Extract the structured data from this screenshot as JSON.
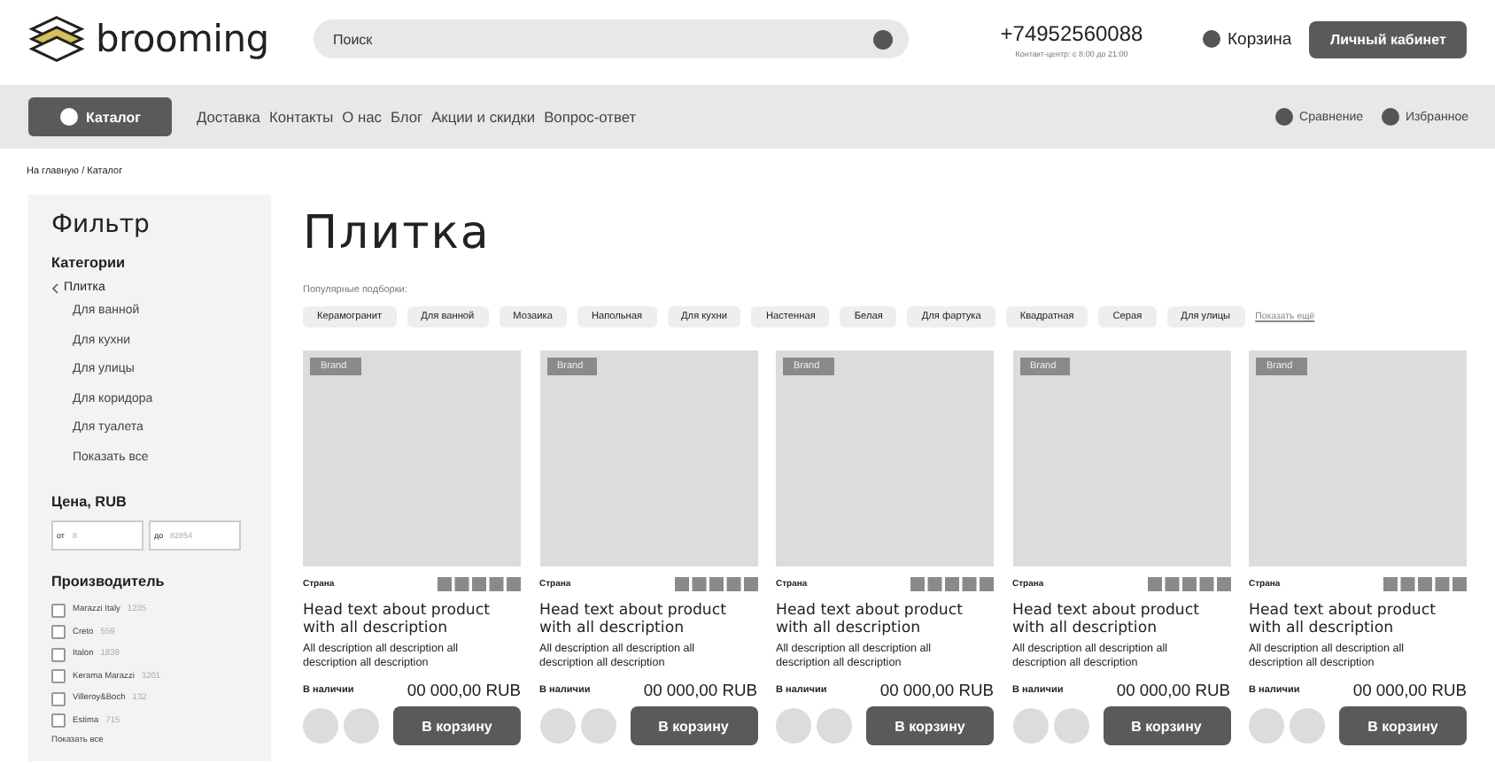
{
  "header": {
    "logo_text": "brooming",
    "search": {
      "placeholder": "Поиск"
    },
    "phone": "+74952560088",
    "phone_note": "Контакт-центр: с 8:00 до 21:00",
    "cart": "Корзина",
    "account_button": "Личный кабинет"
  },
  "nav": {
    "catalog_button": "Каталог",
    "links": [
      "Доставка",
      "Контакты",
      "О нас",
      "Блог",
      "Акции и скидки",
      "Вопрос-ответ"
    ],
    "compare": "Сравнение",
    "favorites": "Избранное"
  },
  "breadcrumb": "На главную / Каталог",
  "filter": {
    "title": "Фильтр",
    "categories_title": "Категории",
    "parent_category": "Плитка",
    "categories": [
      "Для ванной",
      "Для кухни",
      "Для улицы",
      "Для коридора",
      "Для туалета",
      "Показать все"
    ],
    "price_title": "Цена, RUB",
    "price_fields": [
      {
        "label": "от",
        "placeholder": "8"
      },
      {
        "label": "до",
        "placeholder": "82854"
      }
    ],
    "makers_title": "Производитель",
    "makers": [
      {
        "name": "Marazzi Italy",
        "count": "1235",
        "checked": false
      },
      {
        "name": "Creto",
        "count": "559",
        "checked": false
      },
      {
        "name": "Italon",
        "count": "1839",
        "checked": false
      },
      {
        "name": "Kerama Marazzi",
        "count": "3201",
        "checked": false
      },
      {
        "name": "Villeroy&Boch",
        "count": "132",
        "checked": false
      },
      {
        "name": "Estima",
        "count": "715",
        "checked": false
      }
    ],
    "makers_more": "Показать все"
  },
  "page_title": "Плитка",
  "popular": {
    "label": "Популярные подборки:",
    "chips": [
      "Керамогранит",
      "Для ванной",
      "Мозаика",
      "Напольная",
      "Для кухни",
      "Настенная",
      "Белая",
      "Для фартука",
      "Квадратная",
      "Серая",
      "Для улицы"
    ],
    "more": "Показать ещё"
  },
  "products": [
    {
      "brand": "Brand",
      "country": "Страна",
      "title": "Head text about product with all description",
      "description": "All description all description all description all description",
      "stock": "В наличии",
      "price": "00 000,00 RUB",
      "button": "В корзину"
    },
    {
      "brand": "Brand",
      "country": "Страна",
      "title": "Head text about product with all description",
      "description": "All description all description all description all description",
      "stock": "В наличии",
      "price": "00 000,00 RUB",
      "button": "В корзину"
    },
    {
      "brand": "Brand",
      "country": "Страна",
      "title": "Head text about product with all description",
      "description": "All description all description all description all description",
      "stock": "В наличии",
      "price": "00 000,00 RUB",
      "button": "В корзину"
    },
    {
      "brand": "Brand",
      "country": "Страна",
      "title": "Head text about product with all description",
      "description": "All description all description all description all description",
      "stock": "В наличии",
      "price": "00 000,00 RUB",
      "button": "В корзину"
    },
    {
      "brand": "Brand",
      "country": "Страна",
      "title": "Head text about product with all description",
      "description": "All description all description all description all description",
      "stock": "В наличии",
      "price": "00 000,00 RUB",
      "button": "В корзину"
    }
  ]
}
